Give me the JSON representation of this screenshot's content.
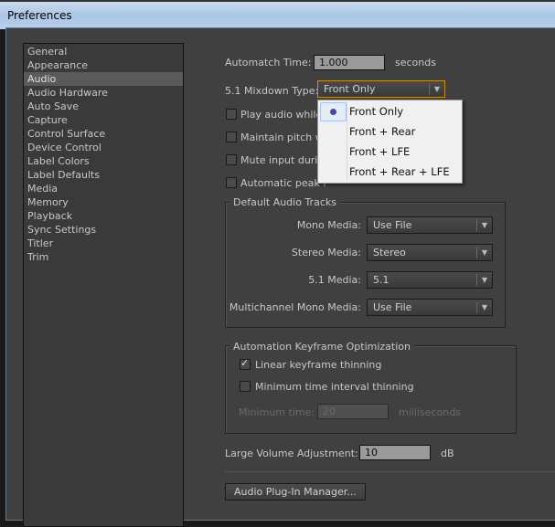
{
  "window": {
    "title": "Preferences"
  },
  "sidebar": {
    "items": [
      "General",
      "Appearance",
      "Audio",
      "Audio Hardware",
      "Auto Save",
      "Capture",
      "Control Surface",
      "Device Control",
      "Label Colors",
      "Label Defaults",
      "Media",
      "Memory",
      "Playback",
      "Sync Settings",
      "Titler",
      "Trim"
    ],
    "selected": "Audio"
  },
  "audio": {
    "automatch_label": "Automatch Time:",
    "automatch_value": "1.000",
    "automatch_unit": "seconds",
    "mixdown_label": "5.1 Mixdown Type:",
    "mixdown_value": "Front Only",
    "mixdown_options": [
      "Front Only",
      "Front + Rear",
      "Front + LFE",
      "Front + Rear + LFE"
    ],
    "checkboxes": [
      {
        "label": "Play audio while",
        "checked": false
      },
      {
        "label": "Maintain pitch wh",
        "checked": false
      },
      {
        "label": "Mute input durin",
        "checked": false
      },
      {
        "label": "Automatic peak f",
        "checked": false
      }
    ],
    "tracks": {
      "title": "Default Audio Tracks",
      "rows": [
        {
          "label": "Mono Media:",
          "value": "Use File"
        },
        {
          "label": "Stereo Media:",
          "value": "Stereo"
        },
        {
          "label": "5.1 Media:",
          "value": "5.1"
        },
        {
          "label": "Multichannel Mono Media:",
          "value": "Use File"
        }
      ]
    },
    "keyframe": {
      "title": "Automation Keyframe Optimization",
      "linear_label": "Linear keyframe thinning",
      "linear_checked": true,
      "min_interval_label": "Minimum time interval thinning",
      "min_interval_checked": false,
      "min_time_label": "Minimum time:",
      "min_time_value": "20",
      "min_time_unit": "milliseconds"
    },
    "volume_label": "Large Volume Adjustment:",
    "volume_value": "10",
    "volume_unit": "dB",
    "plugin_button": "Audio Plug-In Manager..."
  },
  "colors": {
    "accent_focus": "#c8901a",
    "background": "#404040"
  }
}
